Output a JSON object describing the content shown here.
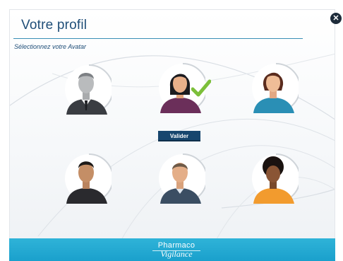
{
  "modal": {
    "title": "Votre profil",
    "subtitle": "Sélectionnez votre Avatar",
    "close_icon": "close-icon"
  },
  "avatars": [
    {
      "id": "man-grey-suit",
      "selected": false
    },
    {
      "id": "woman-dark-hair",
      "selected": true
    },
    {
      "id": "woman-auburn-hair",
      "selected": false
    },
    {
      "id": "man-dark-shirt",
      "selected": false
    },
    {
      "id": "man-bald-suit",
      "selected": false
    },
    {
      "id": "woman-curly-hair",
      "selected": false
    }
  ],
  "validate_label": "Valider",
  "footer": {
    "brand_line1": "Pharmaco",
    "brand_line2": "Vigilance"
  },
  "colors": {
    "title": "#1f4e78",
    "button": "#17466e",
    "footer": "#1aa0cc",
    "checkmark": "#7cbf3a"
  }
}
